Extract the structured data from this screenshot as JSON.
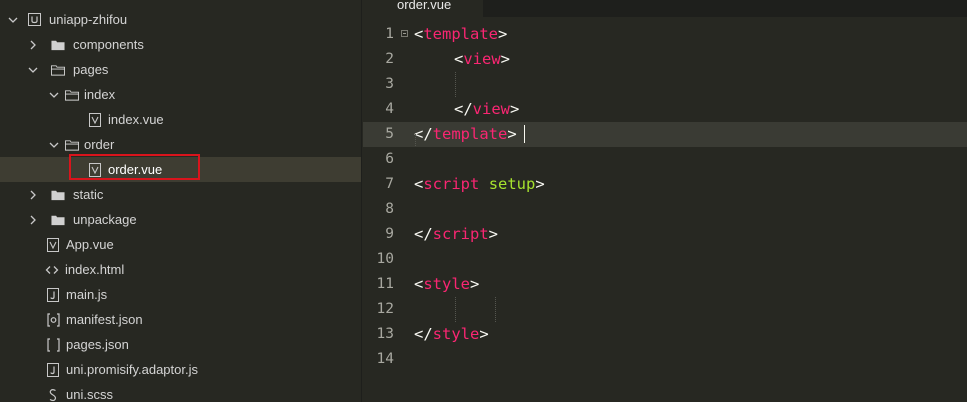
{
  "sidebar": {
    "items": [
      {
        "label": "uniapp-zhifou",
        "icon": "uniapp-project-icon",
        "type": "project",
        "expanded": true
      },
      {
        "label": "components",
        "icon": "folder-icon",
        "type": "folder",
        "expanded": false
      },
      {
        "label": "pages",
        "icon": "folder-open-icon",
        "type": "folder",
        "expanded": true
      },
      {
        "label": "index",
        "icon": "folder-open-icon",
        "type": "folder",
        "expanded": true
      },
      {
        "label": "index.vue",
        "icon": "vue-file-icon",
        "type": "file"
      },
      {
        "label": "order",
        "icon": "folder-open-icon",
        "type": "folder",
        "expanded": true
      },
      {
        "label": "order.vue",
        "icon": "vue-file-icon",
        "type": "file",
        "selected": true
      },
      {
        "label": "static",
        "icon": "folder-icon",
        "type": "folder",
        "expanded": false
      },
      {
        "label": "unpackage",
        "icon": "folder-icon",
        "type": "folder",
        "expanded": false
      },
      {
        "label": "App.vue",
        "icon": "vue-file-icon",
        "type": "file"
      },
      {
        "label": "index.html",
        "icon": "html-file-icon",
        "type": "file"
      },
      {
        "label": "main.js",
        "icon": "js-file-icon",
        "type": "file"
      },
      {
        "label": "manifest.json",
        "icon": "manifest-file-icon",
        "type": "file"
      },
      {
        "label": "pages.json",
        "icon": "json-file-icon",
        "type": "file"
      },
      {
        "label": "uni.promisify.adaptor.js",
        "icon": "js-file-icon",
        "type": "file"
      },
      {
        "label": "uni.scss",
        "icon": "scss-file-icon",
        "type": "file"
      }
    ]
  },
  "editor": {
    "active_tab": "order.vue",
    "current_line": 5,
    "lines": [
      {
        "n": "1",
        "fold": true
      },
      {
        "n": "2"
      },
      {
        "n": "3"
      },
      {
        "n": "4"
      },
      {
        "n": "5"
      },
      {
        "n": "6"
      },
      {
        "n": "7"
      },
      {
        "n": "8"
      },
      {
        "n": "9"
      },
      {
        "n": "10"
      },
      {
        "n": "11"
      },
      {
        "n": "12"
      },
      {
        "n": "13"
      },
      {
        "n": "14"
      }
    ],
    "code": {
      "l1": {
        "open": "<",
        "tag": "template",
        "close": ">"
      },
      "l2": {
        "open": "<",
        "tag": "view",
        "close": ">"
      },
      "l4": {
        "open": "</",
        "tag": "view",
        "close": ">"
      },
      "l5": {
        "open": "</",
        "tag": "template",
        "close": ">"
      },
      "l7": {
        "open": "<",
        "tag": "script",
        "attr": "setup",
        "close": ">"
      },
      "l9": {
        "open": "</",
        "tag": "script",
        "close": ">"
      },
      "l11": {
        "open": "<",
        "tag": "style",
        "close": ">"
      },
      "l13": {
        "open": "</",
        "tag": "style",
        "close": ">"
      }
    }
  },
  "colors": {
    "background": "#272822",
    "tag": "#f92672",
    "attribute": "#a6e22e",
    "punctuation": "#f8f8f2",
    "selection_border": "#d9141c",
    "selected_row": "#3e3d32"
  }
}
